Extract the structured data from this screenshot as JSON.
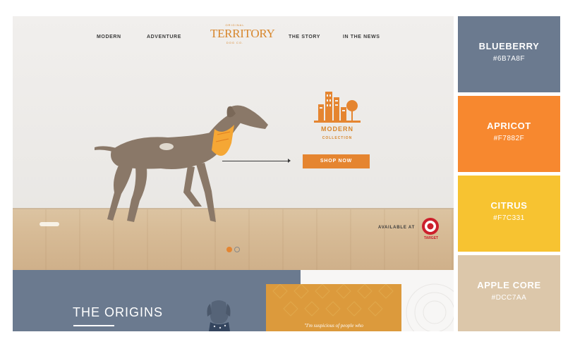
{
  "nav": {
    "links": [
      "MODERN",
      "ADVENTURE",
      "THE STORY",
      "IN THE NEWS"
    ],
    "logo_top": "ORIGINAL",
    "logo": "TERRITORY",
    "logo_bottom": "DOG CO."
  },
  "hero": {
    "collection_title": "MODERN",
    "collection_subtitle": "COLLECTION",
    "shop_button": "SHOP NOW",
    "available_at": "AVAILABLE AT",
    "retailer": "TARGET",
    "slider": {
      "total": 2,
      "active": 1
    }
  },
  "lower": {
    "origins_title": "THE ORIGINS",
    "quote": "\"I'm suspicious of people who"
  },
  "palette": [
    {
      "name": "BLUEBERRY",
      "hex": "#6B7A8F"
    },
    {
      "name": "APRICOT",
      "hex": "#F7882F"
    },
    {
      "name": "CITRUS",
      "hex": "#F7C331"
    },
    {
      "name": "APPLE CORE",
      "hex": "#DCC7AA"
    }
  ]
}
